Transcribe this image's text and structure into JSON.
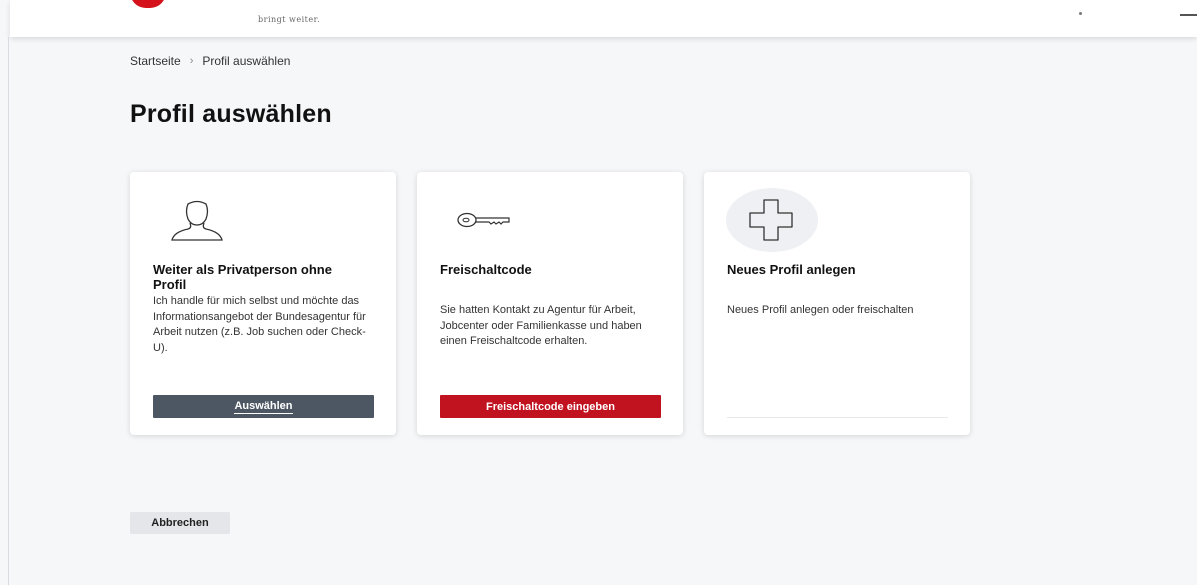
{
  "header": {
    "tagline": "bringt weiter."
  },
  "breadcrumb": {
    "home": "Startseite",
    "separator": "›",
    "current": "Profil auswählen"
  },
  "page": {
    "title": "Profil auswählen"
  },
  "cards": [
    {
      "icon": "person-icon",
      "title": "Weiter als Privatperson ohne Profil",
      "text": "Ich handle für mich selbst und möchte das Informationsangebot der Bundesagentur für Arbeit nutzen (z.B. Job suchen oder Check-U).",
      "button": "Auswählen"
    },
    {
      "icon": "key-icon",
      "title": "Freischaltcode",
      "text": "Sie hatten Kontakt zu Agentur für Arbeit, Jobcenter oder Familienkasse und haben einen Freischaltcode erhalten.",
      "button": "Freischaltcode eingeben"
    },
    {
      "icon": "plus-icon",
      "title": "Neues Profil anlegen",
      "text": "Neues Profil anlegen oder freischalten"
    }
  ],
  "footer": {
    "cancel": "Abbrechen"
  },
  "colors": {
    "brand_red": "#c1121f",
    "button_dark": "#4d5764",
    "page_bg": "#f6f7f9"
  }
}
